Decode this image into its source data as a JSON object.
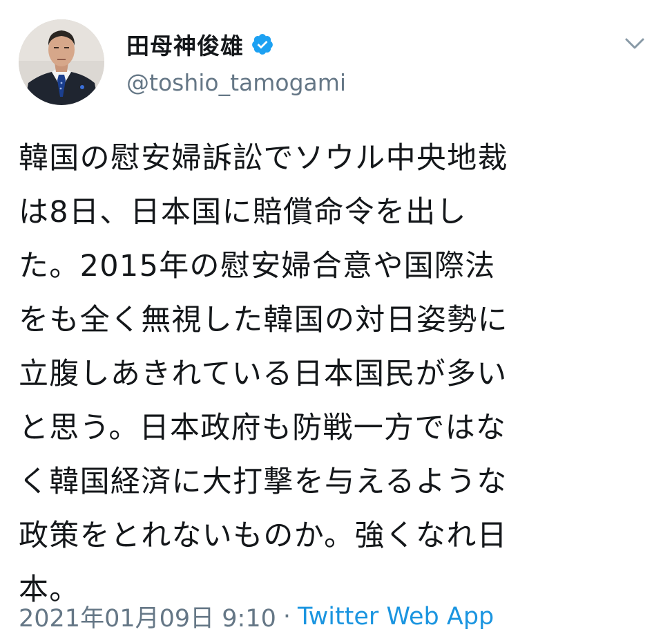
{
  "tweet": {
    "author": {
      "display_name": "田母神俊雄",
      "handle": "@toshio_tamogami",
      "verified": true,
      "verified_icon": "verified-badge-icon",
      "avatar_icon": "profile-photo"
    },
    "menu_icon": "chevron-down-icon",
    "text": "韓国の慰安婦訴訟でソウル中央地裁\nは8日、日本国に賠償命令を出し\nた。2015年の慰安婦合意や国際法\nをも全く無視した韓国の対日姿勢に\n立腹しあきれている日本国民が多い\nと思う。日本政府も防戦一方ではな\nく韓国経済に大打撃を与えるような\n政策をとれないものか。強くなれ日\n本。",
    "timestamp": "2021年01月09日 9:10",
    "separator": "·",
    "source": "Twitter Web App"
  },
  "colors": {
    "text": "#14171a",
    "secondary": "#657786",
    "accent": "#1b95e0",
    "background": "#ffffff"
  }
}
